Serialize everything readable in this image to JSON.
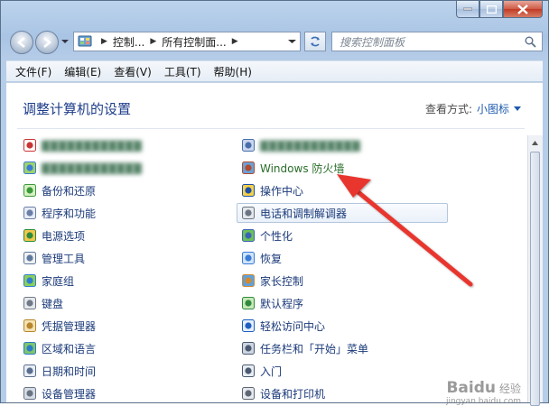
{
  "window": {
    "buttons": {
      "minimize": "minimize-icon",
      "maximize": "maximize-icon",
      "close": "close-icon"
    }
  },
  "nav": {
    "breadcrumbs": [
      "控制...",
      "所有控制面..."
    ],
    "search_placeholder": "搜索控制面板"
  },
  "menu": [
    "文件(F)",
    "编辑(E)",
    "查看(V)",
    "工具(T)",
    "帮助(H)"
  ],
  "header": {
    "title": "调整计算机的设置",
    "view_by_label": "查看方式:",
    "view_by_value": "小图标"
  },
  "items_left": [
    {
      "label": "",
      "icon": "flash-icon",
      "blurred": true
    },
    {
      "label": "",
      "icon": "windows-defender-icon",
      "blurred": true
    },
    {
      "label": "备份和还原",
      "icon": "backup-icon"
    },
    {
      "label": "程序和功能",
      "icon": "programs-icon"
    },
    {
      "label": "电源选项",
      "icon": "power-icon"
    },
    {
      "label": "管理工具",
      "icon": "admin-tools-icon"
    },
    {
      "label": "家庭组",
      "icon": "homegroup-icon"
    },
    {
      "label": "键盘",
      "icon": "keyboard-icon"
    },
    {
      "label": "凭据管理器",
      "icon": "credential-icon"
    },
    {
      "label": "区域和语言",
      "icon": "region-icon"
    },
    {
      "label": "日期和时间",
      "icon": "datetime-icon"
    },
    {
      "label": "设备管理器",
      "icon": "device-manager-icon"
    }
  ],
  "items_right": [
    {
      "label": "",
      "icon": "java-icon",
      "blurred": true
    },
    {
      "label": "Windows 防火墙",
      "icon": "firewall-icon",
      "link": true
    },
    {
      "label": "操作中心",
      "icon": "action-center-icon"
    },
    {
      "label": "电话和调制解调器",
      "icon": "phone-modem-icon",
      "hover": true
    },
    {
      "label": "个性化",
      "icon": "personalize-icon"
    },
    {
      "label": "恢复",
      "icon": "recovery-icon"
    },
    {
      "label": "家长控制",
      "icon": "parental-icon"
    },
    {
      "label": "默认程序",
      "icon": "default-programs-icon"
    },
    {
      "label": "轻松访问中心",
      "icon": "ease-access-icon"
    },
    {
      "label": "任务栏和「开始」菜单",
      "icon": "taskbar-icon"
    },
    {
      "label": "入门",
      "icon": "getting-started-icon"
    },
    {
      "label": "设备和打印机",
      "icon": "printer-icon"
    }
  ],
  "watermark": {
    "brand": "Baidu",
    "sub": "经验",
    "url": "jingyan.baidu.com"
  },
  "colors": {
    "title": "#1e3d8a",
    "link": "#1b3a7a",
    "arrow": "#e8352e"
  }
}
